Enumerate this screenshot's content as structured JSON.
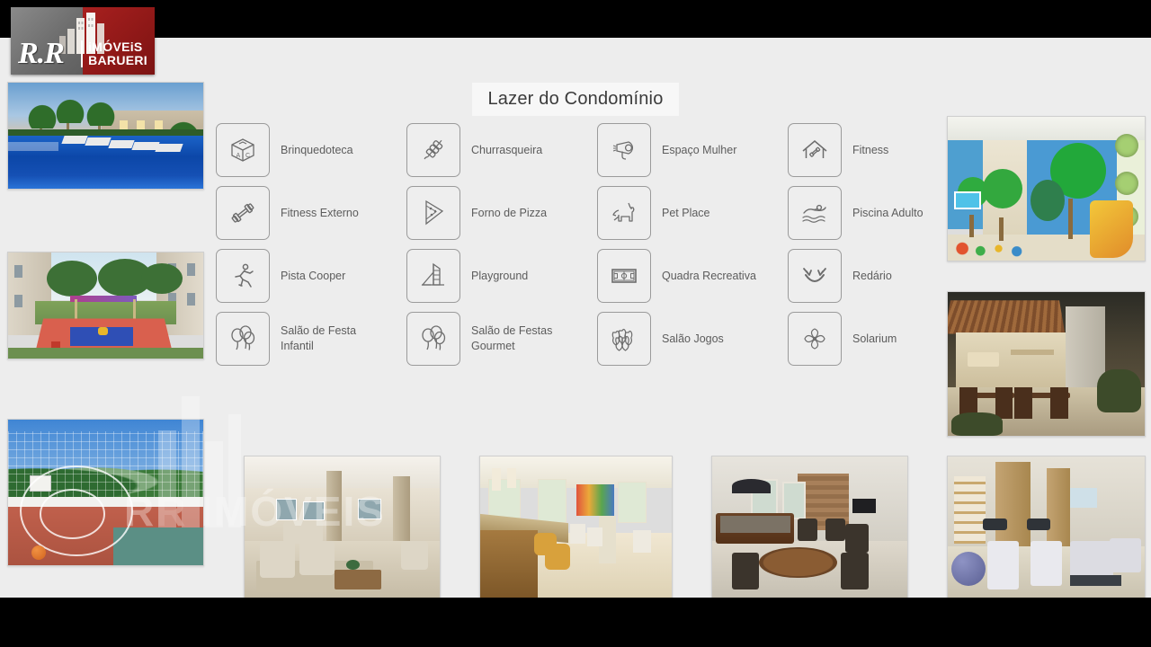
{
  "slide": {
    "title": "Lazer do Condomínio",
    "background_color": "#ededed",
    "letterbox_color": "#000000"
  },
  "logo": {
    "name": "R.R",
    "mark_left": "R.R",
    "side_line1": "iMÓVEiS",
    "side_line2": "BARUERI",
    "colors": {
      "gray": "#6e6e6e",
      "red": "#8e1817",
      "text": "#ffffff"
    }
  },
  "watermark": {
    "text": "RR IMÓVEIS"
  },
  "amenities": {
    "columns": [
      {
        "items": [
          {
            "label": "Brinquedoteca",
            "icon": "toy-block-icon"
          },
          {
            "label": "Fitness Externo",
            "icon": "dumbbell-icon"
          },
          {
            "label": "Pista Cooper",
            "icon": "runner-icon"
          },
          {
            "label": "Salão de Festa Infantil",
            "icon": "balloons-icon"
          }
        ]
      },
      {
        "items": [
          {
            "label": "Churrasqueira",
            "icon": "skewer-icon"
          },
          {
            "label": "Forno de Pizza",
            "icon": "pizza-slice-icon"
          },
          {
            "label": "Playground",
            "icon": "playground-slide-icon"
          },
          {
            "label": "Salão de Festas Gourmet",
            "icon": "balloons-icon"
          }
        ]
      },
      {
        "items": [
          {
            "label": "Espaço Mulher",
            "icon": "hairdryer-icon"
          },
          {
            "label": "Pet Place",
            "icon": "dog-icon"
          },
          {
            "label": "Quadra Recreativa",
            "icon": "sports-field-icon"
          },
          {
            "label": "Salão Jogos",
            "icon": "bowling-pins-icon"
          }
        ]
      },
      {
        "items": [
          {
            "label": "Fitness",
            "icon": "house-dumbbell-icon"
          },
          {
            "label": "Piscina Adulto",
            "icon": "swimmer-icon"
          },
          {
            "label": "Redário",
            "icon": "hammock-icon"
          },
          {
            "label": "Solarium",
            "icon": "pinwheel-icon"
          }
        ]
      }
    ]
  },
  "photos": {
    "left": [
      {
        "alt": "Piscina adulto com espreguiçadeiras e palmeiras ao entardecer"
      },
      {
        "alt": "Playground infantil colorido entre os prédios"
      }
    ],
    "right": [
      {
        "alt": "Brinquedoteca com painéis de árvores e escorregador"
      },
      {
        "alt": "Espaço gourmet / churrasqueira com pergolado e mesas"
      }
    ],
    "bottom": [
      {
        "alt": "Quadra recreativa poliesportiva com alambrado"
      },
      {
        "alt": "Salão de festas com poltronas e mesa de centro"
      },
      {
        "alt": "Salão gourmet com balcão e banquetas"
      },
      {
        "alt": "Salão de jogos com mesa de sinuca e mesa redonda"
      },
      {
        "alt": "Academia fitness com bicicletas e esteiras"
      }
    ]
  }
}
